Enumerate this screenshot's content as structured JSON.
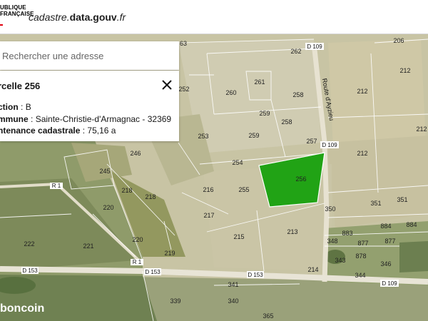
{
  "header": {
    "republique_line1": "UBLIQUE",
    "republique_line2": "FRANÇAISE",
    "site_prefix": "cadastre.",
    "site_bold": "data.gouv",
    "site_suffix": ".fr"
  },
  "search": {
    "placeholder": "Rechercher une adresse"
  },
  "panel": {
    "title": "rcelle 256",
    "section_label": "ction",
    "section_value": "B",
    "commune_label": "mmune",
    "commune_value": "Sainte-Christie-d'Armagnac - 32369",
    "contenance_label": "ntenance cadastrale",
    "contenance_value": "75,16 a"
  },
  "watermark": "boncoin",
  "map": {
    "roads": {
      "d109_top": "D 109",
      "d109_mid": "D 109",
      "d109_right": "D 109",
      "route_name": "Route d'Ayzieu",
      "r1_left": "R 1",
      "r1_mid": "R 1",
      "d153_left": "D 153",
      "d153_mid": "D 153",
      "d153_right": "D 153"
    },
    "parcel_labels": [
      {
        "id": "p63",
        "text": "63"
      },
      {
        "id": "p262",
        "text": "262"
      },
      {
        "id": "p206",
        "text": "206"
      },
      {
        "id": "p212a",
        "text": "212"
      },
      {
        "id": "p252",
        "text": "252"
      },
      {
        "id": "p261",
        "text": "261"
      },
      {
        "id": "p260",
        "text": "260"
      },
      {
        "id": "p258a",
        "text": "258"
      },
      {
        "id": "p212b",
        "text": "212"
      },
      {
        "id": "p259a",
        "text": "259"
      },
      {
        "id": "p258b",
        "text": "258"
      },
      {
        "id": "p212c",
        "text": "212"
      },
      {
        "id": "p253",
        "text": "253"
      },
      {
        "id": "p259b",
        "text": "259"
      },
      {
        "id": "p257",
        "text": "257"
      },
      {
        "id": "p212d",
        "text": "212"
      },
      {
        "id": "p246",
        "text": "246"
      },
      {
        "id": "p254",
        "text": "254"
      },
      {
        "id": "p256",
        "text": "256"
      },
      {
        "id": "p245",
        "text": "245"
      },
      {
        "id": "p216",
        "text": "216"
      },
      {
        "id": "p218a",
        "text": "218"
      },
      {
        "id": "p255",
        "text": "255"
      },
      {
        "id": "p351a",
        "text": "351"
      },
      {
        "id": "p351b",
        "text": "351"
      },
      {
        "id": "p218b",
        "text": "218"
      },
      {
        "id": "p220a",
        "text": "220"
      },
      {
        "id": "p350",
        "text": "350"
      },
      {
        "id": "p217",
        "text": "217"
      },
      {
        "id": "p884a",
        "text": "884"
      },
      {
        "id": "p884b",
        "text": "884"
      },
      {
        "id": "p213",
        "text": "213"
      },
      {
        "id": "p883",
        "text": "883"
      },
      {
        "id": "p215",
        "text": "215"
      },
      {
        "id": "p220b",
        "text": "220"
      },
      {
        "id": "p348",
        "text": "348"
      },
      {
        "id": "p877a",
        "text": "877"
      },
      {
        "id": "p877b",
        "text": "877"
      },
      {
        "id": "p222",
        "text": "222"
      },
      {
        "id": "p221",
        "text": "221"
      },
      {
        "id": "p219",
        "text": "219"
      },
      {
        "id": "p878",
        "text": "878"
      },
      {
        "id": "p343",
        "text": "343"
      },
      {
        "id": "p346",
        "text": "346"
      },
      {
        "id": "p214",
        "text": "214"
      },
      {
        "id": "p344",
        "text": "344"
      },
      {
        "id": "p341",
        "text": "341"
      },
      {
        "id": "p340",
        "text": "340"
      },
      {
        "id": "p339",
        "text": "339"
      },
      {
        "id": "p365",
        "text": "365"
      }
    ]
  },
  "colors": {
    "selected_parcel": "#21a315",
    "header_red": "#e1000f"
  }
}
